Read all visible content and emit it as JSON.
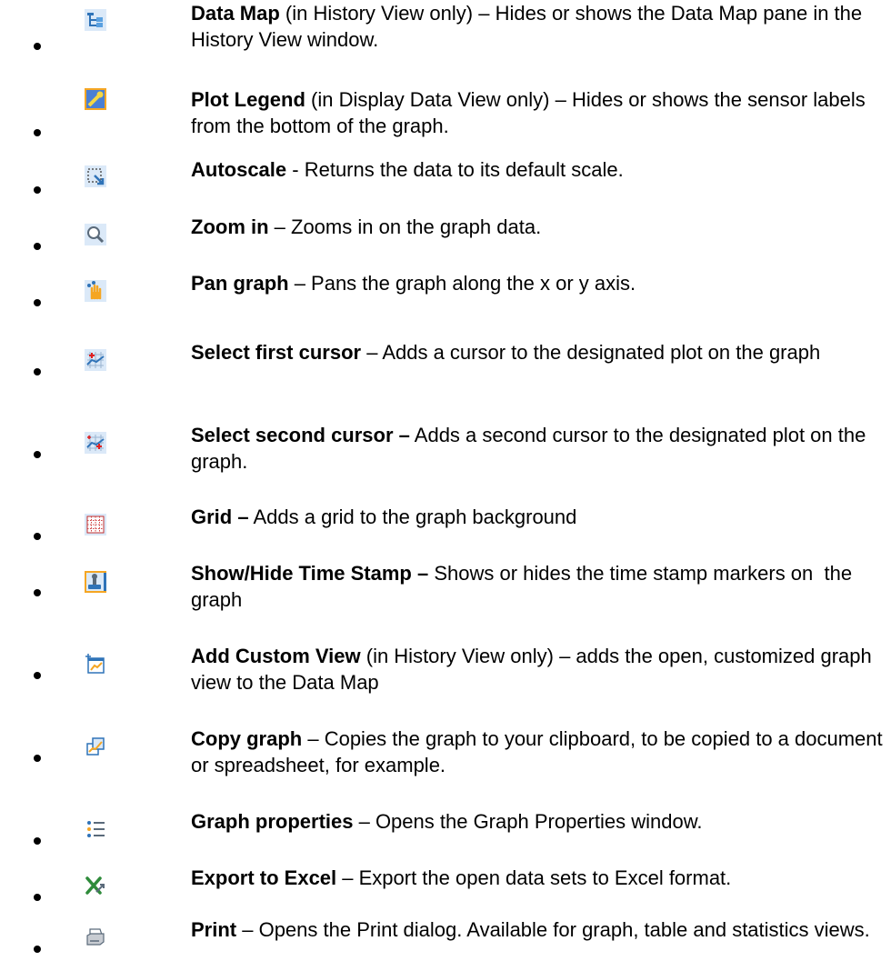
{
  "items": [
    {
      "icon": "data-map-icon",
      "title": "Data Map",
      "qualifier": " (in History View only) ",
      "desc": "– Hides or shows the Data Map pane in the History View window."
    },
    {
      "icon": "plot-legend-icon",
      "title": "Plot Legend",
      "qualifier": " (in Display Data View only) ",
      "desc": "– Hides or shows the sensor labels from the bottom of the graph."
    },
    {
      "icon": "autoscale-icon",
      "title": "Autoscale",
      "qualifier": "",
      "desc": " - Returns the data to its default scale."
    },
    {
      "icon": "zoom-in-icon",
      "title": "Zoom in",
      "qualifier": "",
      "desc": " – Zooms in on the graph data."
    },
    {
      "icon": "pan-graph-icon",
      "title": "Pan graph",
      "qualifier": "",
      "desc": " – Pans the graph along the x or y axis."
    },
    {
      "icon": "first-cursor-icon",
      "title": "Select first cursor",
      "qualifier": "",
      "desc": " – Adds a cursor to the designated plot on the graph"
    },
    {
      "icon": "second-cursor-icon",
      "title": "Select second cursor –",
      "qualifier": "",
      "desc": " Adds a second cursor to the designated plot on the graph."
    },
    {
      "icon": "grid-icon",
      "title": "Grid –",
      "qualifier": "",
      "desc": " Adds a grid to the graph background"
    },
    {
      "icon": "time-stamp-icon",
      "title": "Show/Hide Time Stamp –",
      "qualifier": "",
      "desc": " Shows or hides the time stamp markers on  the graph"
    },
    {
      "icon": "add-custom-view-icon",
      "title": "Add Custom View",
      "qualifier": " (in History View only) ",
      "desc": "– adds the open, customized graph view to the Data Map"
    },
    {
      "icon": "copy-graph-icon",
      "title": "Copy graph",
      "qualifier": "",
      "desc": " – Copies the graph to your clipboard, to be copied to a document or spreadsheet, for example."
    },
    {
      "icon": "graph-properties-icon",
      "title": "Graph properties",
      "qualifier": "",
      "desc": " – Opens the Graph Properties window."
    },
    {
      "icon": "export-excel-icon",
      "title": "Export to Excel",
      "qualifier": "",
      "desc": " – Export the open data sets to Excel format."
    },
    {
      "icon": "print-icon",
      "title": "Print",
      "qualifier": "",
      "desc": " – Opens the Print dialog. Available for graph, table and statistics views."
    }
  ]
}
